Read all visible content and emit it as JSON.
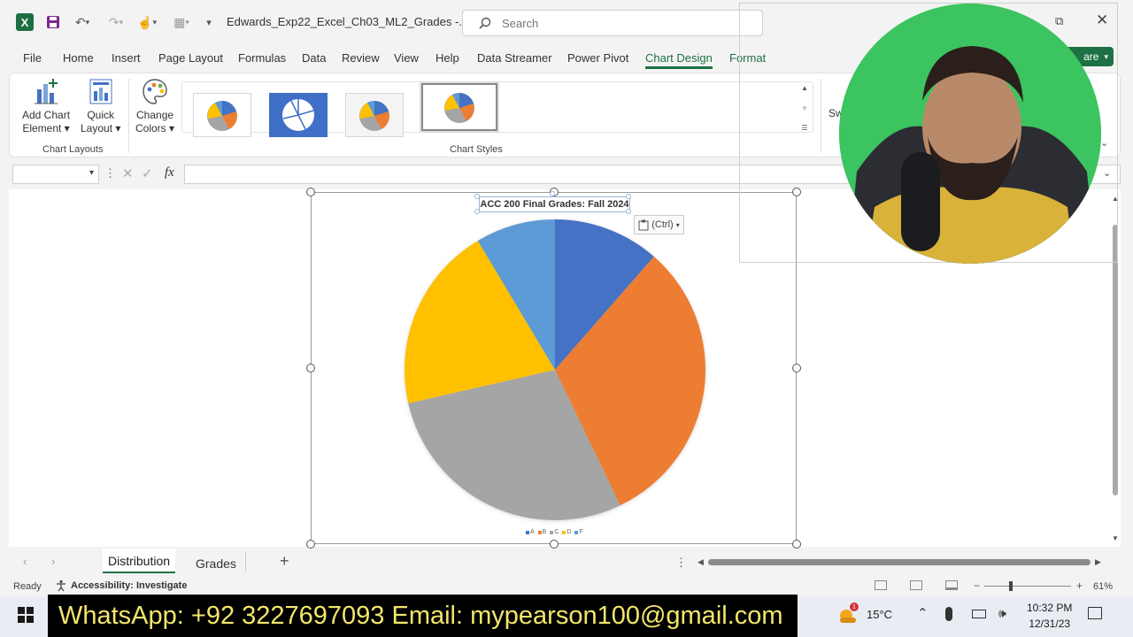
{
  "window": {
    "app_icon": "X",
    "title": "Edwards_Exp22_Excel_Ch03_ML2_Grades  -...",
    "search_placeholder": "Search",
    "share_label": "are"
  },
  "menu": {
    "file": "File",
    "home": "Home",
    "insert": "Insert",
    "page_layout": "Page Layout",
    "formulas": "Formulas",
    "data": "Data",
    "review": "Review",
    "view": "View",
    "help": "Help",
    "data_streamer": "Data Streamer",
    "power_pivot": "Power Pivot",
    "chart_design": "Chart Design",
    "format": "Format"
  },
  "ribbon": {
    "add_chart_element_1": "Add Chart",
    "add_chart_element_2": "Element",
    "quick_layout_1": "Quick",
    "quick_layout_2": "Layout",
    "change_colors_1": "Change",
    "change_colors_2": "Colors",
    "chart_layouts_label": "Chart Layouts",
    "chart_styles_label": "Chart Styles",
    "switch_partial": "Sw"
  },
  "formula_bar": {
    "fx_label": "fx",
    "name_box_value": "",
    "formula_value": ""
  },
  "chart": {
    "paste_options": "(Ctrl)"
  },
  "chart_data": {
    "type": "pie",
    "title": "ACC 200 Final Grades: Fall 2024",
    "categories": [
      "A",
      "B",
      "C",
      "D",
      "F"
    ],
    "values": [
      4,
      11,
      10,
      7,
      3
    ],
    "colors": [
      "#4472c4",
      "#ed7d31",
      "#a5a5a5",
      "#ffc000",
      "#5b9bd5"
    ],
    "legend_position": "bottom"
  },
  "sheets": {
    "tab1": "Distribution",
    "tab2": "Grades"
  },
  "status": {
    "ready": "Ready",
    "accessibility": "Accessibility: Investigate",
    "zoom": "61%"
  },
  "taskbar": {
    "temperature": "15°C",
    "weather_badge": "1",
    "time": "10:32 PM",
    "date": "12/31/23"
  },
  "banner": {
    "text": "WhatsApp: +92 3227697093  Email: mypearson100@gmail.com"
  }
}
